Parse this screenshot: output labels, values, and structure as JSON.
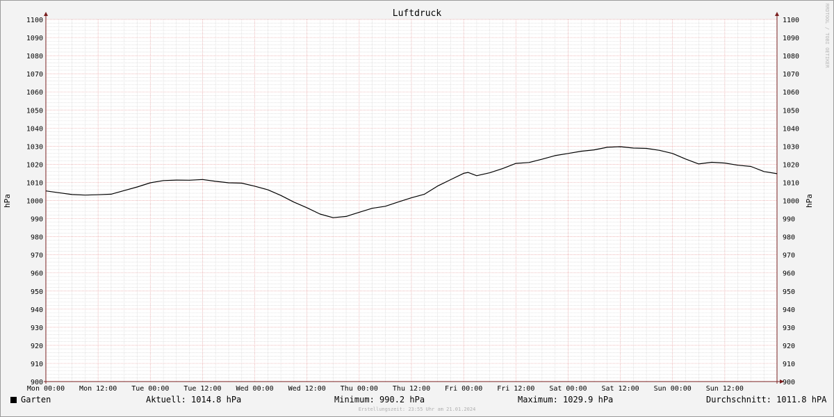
{
  "chart_data": {
    "type": "line",
    "title": "Luftdruck",
    "ylabel": "hPa",
    "ylim": [
      900,
      1100
    ],
    "y_major_step": 10,
    "y_minor_step": 2,
    "x_ticks": [
      "Mon 00:00",
      "Mon 12:00",
      "Tue 00:00",
      "Tue 12:00",
      "Wed 00:00",
      "Wed 12:00",
      "Thu 00:00",
      "Thu 12:00",
      "Fri 00:00",
      "Fri 12:00",
      "Sat 00:00",
      "Sat 12:00",
      "Sun 00:00",
      "Sun 12:00"
    ],
    "x_unit": "hours since Mon 00:00",
    "xlim": [
      0,
      168
    ],
    "grid": true,
    "series": [
      {
        "name": "Garten",
        "color": "#000000",
        "x": [
          0,
          3,
          6,
          9,
          12,
          15,
          18,
          21,
          24,
          27,
          30,
          33,
          36,
          39,
          42,
          45,
          48,
          51,
          54,
          57,
          60,
          63,
          66,
          69,
          72,
          75,
          78,
          81,
          84,
          87,
          90,
          93,
          96,
          97,
          99,
          102,
          105,
          108,
          111,
          114,
          117,
          120,
          123,
          126,
          129,
          132,
          135,
          138,
          141,
          144,
          147,
          150,
          153,
          156,
          159,
          162,
          165,
          168
        ],
        "values": [
          1005.3,
          1004.3,
          1003.3,
          1003.0,
          1003.2,
          1003.5,
          1005.5,
          1007.5,
          1009.8,
          1011.0,
          1011.3,
          1011.2,
          1011.6,
          1010.6,
          1009.8,
          1009.6,
          1007.9,
          1005.9,
          1002.8,
          999.1,
          996.0,
          992.5,
          990.5,
          991.2,
          993.5,
          995.7,
          996.8,
          999.2,
          1001.5,
          1003.5,
          1008.0,
          1011.5,
          1015.0,
          1015.5,
          1013.7,
          1015.3,
          1017.7,
          1020.5,
          1021.0,
          1022.8,
          1024.8,
          1026.0,
          1027.2,
          1028.0,
          1029.4,
          1029.7,
          1029.0,
          1028.8,
          1027.7,
          1026.0,
          1022.9,
          1020.2,
          1021.1,
          1020.7,
          1019.5,
          1018.8,
          1016.0,
          1014.8
        ]
      }
    ]
  },
  "legend": {
    "series_name": "Garten",
    "aktuell": "Aktuell: 1014.8 hPa",
    "minimum": "Minimum: 990.2 hPa",
    "maximum": "Maximum: 1029.9 hPa",
    "durchschnitt": "Durchschnitt: 1011.8 hPA"
  },
  "footer": "Erstellungszeit: 23:55 Uhr am 21.01.2024",
  "watermark": "RRDTOOL / TOBI OETIKER",
  "colors": {
    "background": "#f3f3f3",
    "plot_background": "#ffffff",
    "major_grid": "#e8a0a0",
    "minor_grid": "#cfcfcf",
    "axis": "#7a1f1f",
    "line": "#000000"
  }
}
